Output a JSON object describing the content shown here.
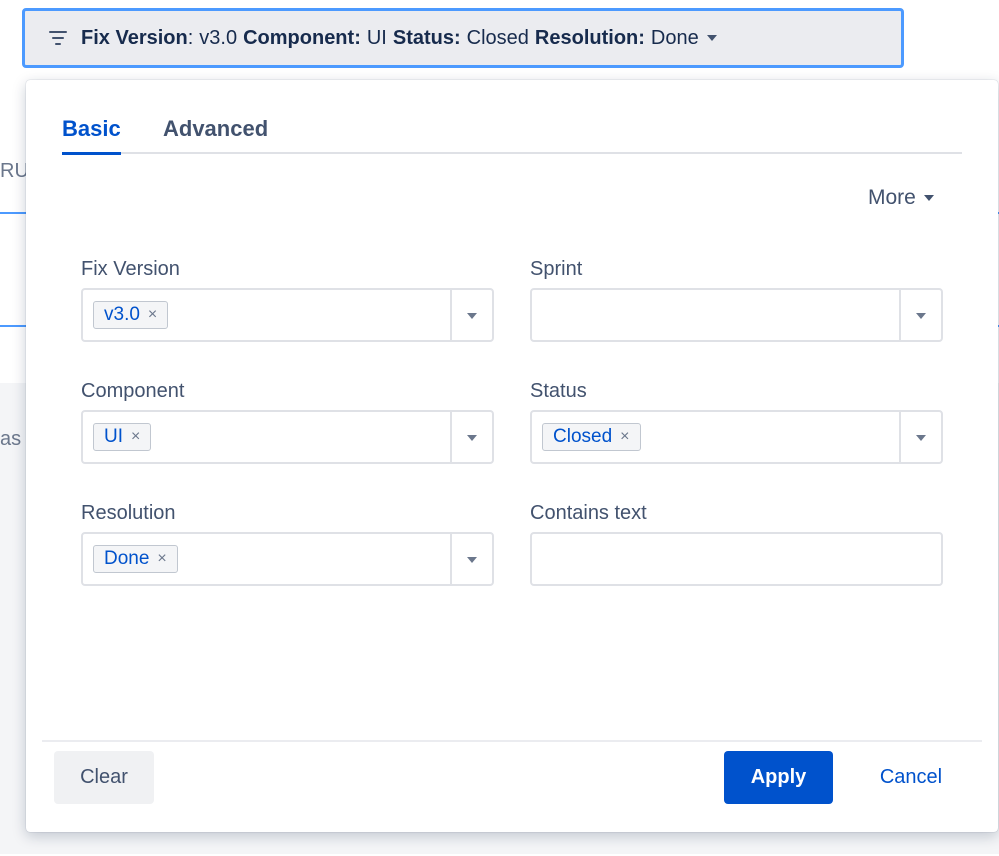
{
  "background": {
    "fragment_1": "RU",
    "fragment_2": "as"
  },
  "filter_trigger": {
    "fix_version_key": "Fix Version",
    "fix_version_value": "v3.0",
    "component_key": "Component:",
    "component_value": "UI",
    "status_key": "Status:",
    "status_value": "Closed",
    "resolution_key": "Resolution:",
    "resolution_value": "Done"
  },
  "tabs": [
    {
      "label": "Basic",
      "active": true
    },
    {
      "label": "Advanced",
      "active": false
    }
  ],
  "more_label": "More",
  "fields": {
    "fix_version": {
      "label": "Fix Version",
      "chip": "v3.0",
      "chip_remove": "×"
    },
    "sprint": {
      "label": "Sprint"
    },
    "component": {
      "label": "Component",
      "chip": "UI",
      "chip_remove": "×"
    },
    "status": {
      "label": "Status",
      "chip": "Closed",
      "chip_remove": "×"
    },
    "resolution": {
      "label": "Resolution",
      "chip": "Done",
      "chip_remove": "×"
    },
    "contains_text": {
      "label": "Contains text",
      "value": ""
    }
  },
  "buttons": {
    "clear": "Clear",
    "apply": "Apply",
    "cancel": "Cancel"
  },
  "colors": {
    "accent": "#0052cc",
    "focus_ring": "#4c9aff",
    "trigger_bg": "#ebecf0"
  }
}
